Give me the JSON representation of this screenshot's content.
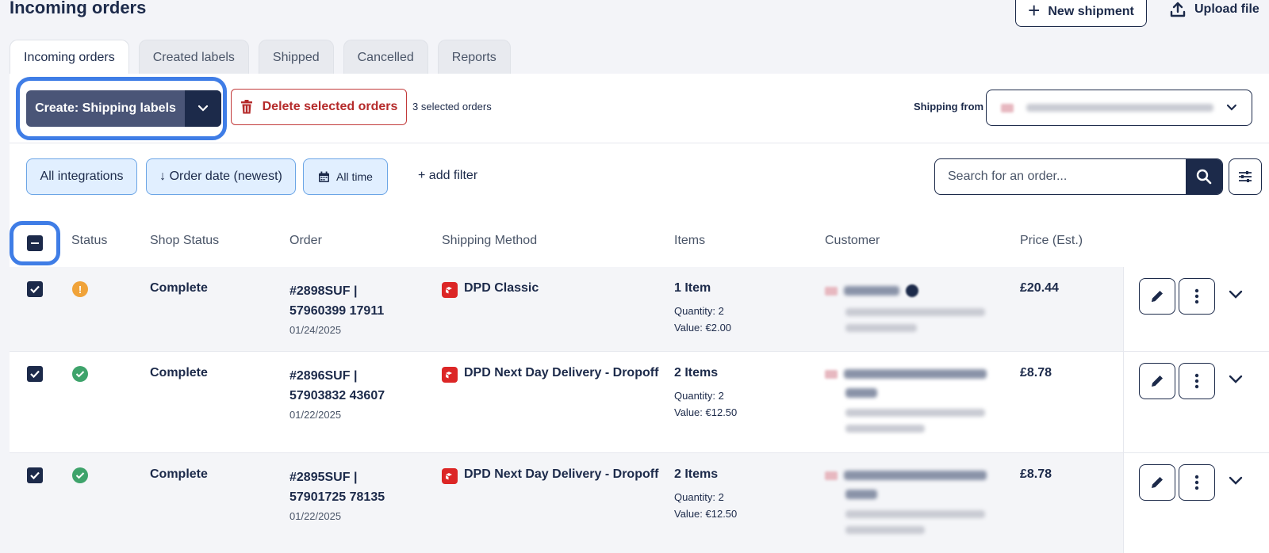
{
  "page": {
    "title": "Incoming orders"
  },
  "header": {
    "new_shipment_label": "New shipment",
    "upload_file_label": "Upload file"
  },
  "tabs": [
    {
      "label": "Incoming orders",
      "active": true
    },
    {
      "label": "Created labels",
      "active": false
    },
    {
      "label": "Shipped",
      "active": false
    },
    {
      "label": "Cancelled",
      "active": false
    },
    {
      "label": "Reports",
      "active": false
    }
  ],
  "toolbar": {
    "create_label": "Create: Shipping labels",
    "delete_label": "Delete selected orders",
    "selected_count": "3 selected orders",
    "shipping_from_label": "Shipping from"
  },
  "filters": {
    "integrations": "All integrations",
    "order_date": "↓ Order date (newest)",
    "time": "All time",
    "add_filter": "+ add filter",
    "search_placeholder": "Search for an order..."
  },
  "table": {
    "columns": [
      "Status",
      "Shop Status",
      "Order",
      "Shipping Method",
      "Items",
      "Customer",
      "Price (Est.)"
    ],
    "rows": [
      {
        "status": "warning",
        "shop_status": "Complete",
        "order": "#2898SUF | 57960399 17911",
        "date": "01/24/2025",
        "shipping_method": "DPD Classic",
        "items": "1 Item",
        "quantity": "Quantity: 2",
        "value": "Value: €2.00",
        "price": "£20.44"
      },
      {
        "status": "ok",
        "shop_status": "Complete",
        "order": "#2896SUF | 57903832 43607",
        "date": "01/22/2025",
        "shipping_method": "DPD Next Day Delivery - Dropoff",
        "items": "2 Items",
        "quantity": "Quantity: 2",
        "value": "Value: €12.50",
        "price": "£8.78"
      },
      {
        "status": "ok",
        "shop_status": "Complete",
        "order": "#2895SUF | 57901725 78135",
        "date": "01/22/2025",
        "shipping_method": "DPD Next Day Delivery - Dropoff",
        "items": "2 Items",
        "quantity": "Quantity: 2",
        "value": "Value: €12.50",
        "price": "£8.78"
      }
    ]
  },
  "colors": {
    "navy": "#1c2a4a",
    "accent_ring": "#3f7de6",
    "danger": "#b52b2b",
    "warning": "#f0a33a",
    "success": "#3ea36b"
  }
}
